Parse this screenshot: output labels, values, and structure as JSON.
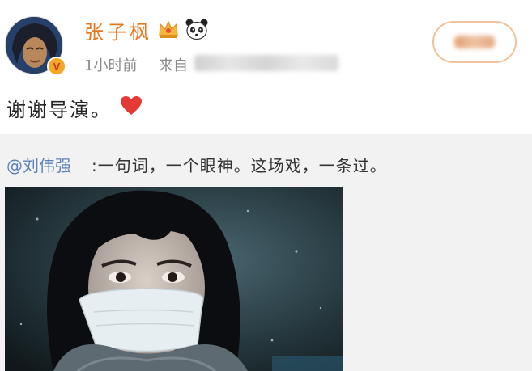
{
  "post": {
    "username": "张子枫",
    "time": "1小时前",
    "source_label": "来自",
    "text": "谢谢导演。",
    "badge_letter": "V"
  },
  "repost": {
    "author": "@刘伟强",
    "text": ":一句词，一个眼神。这场戏，一条过。"
  },
  "icons": [
    "verified-badge-icon",
    "vip-crown-icon",
    "panda-icon",
    "heart-icon"
  ],
  "colors": {
    "username": "#e5771e",
    "mention": "#5c83b8",
    "meta": "#8a8a8a",
    "repost_bg": "#f2f2f2",
    "follow_border": "#f0c39a",
    "heart": "#e53935"
  }
}
